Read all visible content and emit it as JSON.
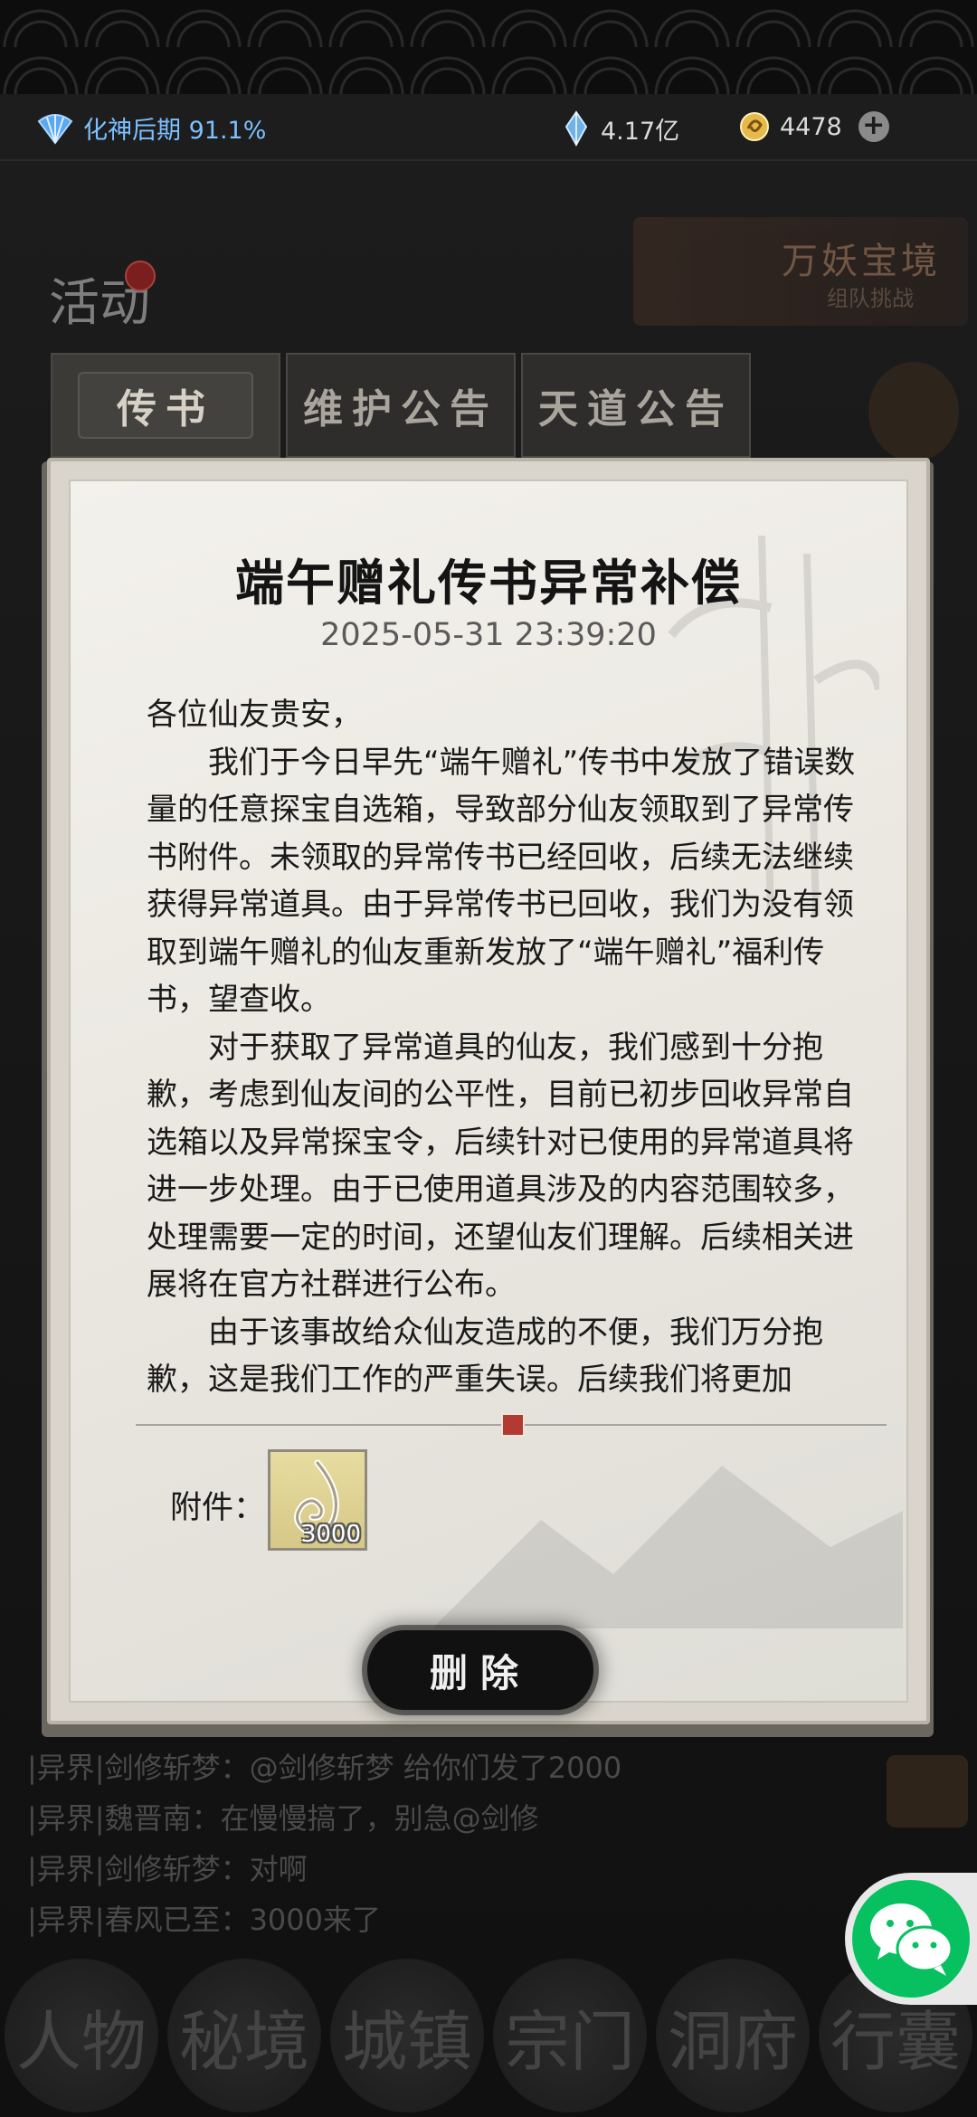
{
  "status_bar": {
    "realm_text": "化神后期 91.1%",
    "spirit_stone": "4.17亿",
    "coins": "4478",
    "plus_label": "+"
  },
  "background": {
    "activity_label": "活动",
    "event_banner_title": "万妖宝境",
    "event_banner_sub": "组队挑战",
    "chat_lines": [
      "|异界|剑修斩梦：@剑修斩梦 给你们发了2000",
      "|异界|魏晋南：在慢慢搞了，别急@剑修",
      "|异界|剑修斩梦：对啊",
      "|异界|春风已至：3000来了"
    ],
    "nav_items": [
      "人物",
      "秘境",
      "城镇",
      "宗门",
      "洞府",
      "行囊"
    ]
  },
  "tabs": [
    {
      "label": "传书",
      "active": true
    },
    {
      "label": "维护公告",
      "active": false
    },
    {
      "label": "天道公告",
      "active": false
    }
  ],
  "letter": {
    "title": "端午赠礼传书异常补偿",
    "date": "2025-05-31 23:39:20",
    "greeting": "各位仙友贵安，",
    "paragraphs": [
      "我们于今日早先“端午赠礼”传书中发放了错误数量的任意探宝自选箱，导致部分仙友领取到了异常传书附件。未领取的异常传书已经回收，后续无法继续获得异常道具。由于异常传书已回收，我们为没有领取到端午赠礼的仙友重新发放了“端午赠礼”福利传书，望查收。",
      "对于获取了异常道具的仙友，我们感到十分抱歉，考虑到仙友间的公平性，目前已初步回收异常自选箱以及异常探宝令，后续针对已使用的异常道具将进一步处理。由于已使用道具涉及的内容范围较多，处理需要一定的时间，还望仙友们理解。后续相关进展将在官方社群进行公布。",
      "由于该事故给众仙友造成的不便，我们万分抱歉，这是我们工作的严重失误。后续我们将更加"
    ],
    "attachment_label": "附件：",
    "attachment_count": "3000",
    "delete_label": "删除"
  },
  "colors": {
    "realm_blue": "#7cc0ff",
    "wechat_green": "#07c160",
    "seal_red": "#b33a30"
  }
}
